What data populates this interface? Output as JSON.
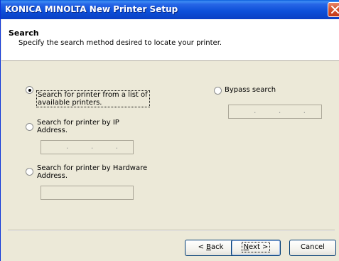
{
  "window": {
    "title": "KONICA MINOLTA New Printer Setup"
  },
  "header": {
    "title": "Search",
    "subtitle": "Specify the search method desired to locate your printer."
  },
  "options": [
    {
      "label": "Search for printer from a list of\navailable printers.",
      "selected": true
    },
    {
      "label": "Search for printer by IP\nAddress.",
      "selected": false
    },
    {
      "label": "Search for printer by Hardware\nAddress.",
      "selected": false
    },
    {
      "label": "Bypass search",
      "selected": false
    }
  ],
  "fields": {
    "ip_address_value": ". . .",
    "hardware_address_value": "",
    "bypass_value": ". . ."
  },
  "buttons": {
    "back": {
      "prefix": "< ",
      "mnemonic": "B",
      "rest": "ack"
    },
    "next": {
      "mnemonic": "N",
      "rest": "ext >"
    },
    "cancel": "Cancel"
  },
  "icons": {
    "close": "close-x-icon"
  },
  "colors": {
    "titlebar": "#0C4FD8",
    "close_button": "#D6542F",
    "dialog_background": "#ECE9D8",
    "header_background": "#FFFFFF"
  }
}
